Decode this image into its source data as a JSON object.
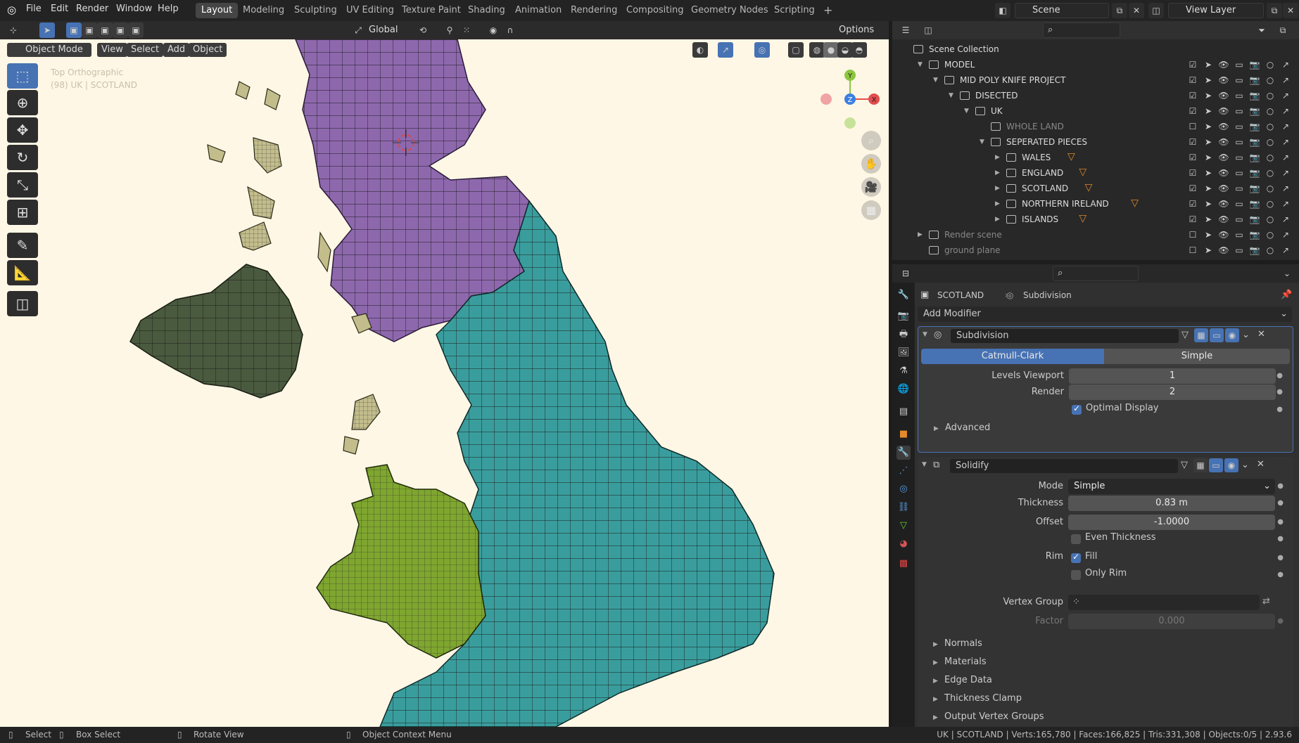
{
  "menu": {
    "file": "File",
    "edit": "Edit",
    "render": "Render",
    "window": "Window",
    "help": "Help"
  },
  "workspaces": [
    "Layout",
    "Modeling",
    "Sculpting",
    "UV Editing",
    "Texture Paint",
    "Shading",
    "Animation",
    "Rendering",
    "Compositing",
    "Geometry Nodes",
    "Scripting"
  ],
  "scene": "Scene",
  "view_layer": "View Layer",
  "viewport": {
    "orientation": "Global",
    "options": "Options",
    "mode": "Object Mode",
    "view": "View",
    "select": "Select",
    "add": "Add",
    "object": "Object",
    "overlay_title": "Top Orthographic",
    "overlay_sub": "(98) UK | SCOTLAND"
  },
  "gizmo": {
    "x": "X",
    "y": "Y",
    "z": "Z"
  },
  "outliner": {
    "rows": [
      {
        "label": "Scene Collection"
      },
      {
        "label": "MODEL"
      },
      {
        "label": "MID POLY KNIFE PROJECT"
      },
      {
        "label": "DISECTED"
      },
      {
        "label": "UK"
      },
      {
        "label": "WHOLE LAND"
      },
      {
        "label": "SEPERATED PIECES"
      },
      {
        "label": "WALES"
      },
      {
        "label": "ENGLAND"
      },
      {
        "label": "SCOTLAND"
      },
      {
        "label": "NORTHERN IRELAND"
      },
      {
        "label": "ISLANDS"
      },
      {
        "label": "Render scene"
      },
      {
        "label": "ground plane"
      }
    ]
  },
  "props": {
    "breadcrumb_object": "SCOTLAND",
    "breadcrumb_modifier": "Subdivision",
    "add_modifier": "Add Modifier",
    "subdivision": {
      "name": "Subdivision",
      "catmull": "Catmull-Clark",
      "simple": "Simple",
      "levels_label": "Levels Viewport",
      "levels": "1",
      "render_label": "Render",
      "render": "2",
      "optimal": "Optimal Display",
      "advanced": "Advanced"
    },
    "solidify": {
      "name": "Solidify",
      "mode_label": "Mode",
      "mode": "Simple",
      "thickness_label": "Thickness",
      "thickness": "0.83 m",
      "offset_label": "Offset",
      "offset": "-1.0000",
      "even": "Even Thickness",
      "rim_label": "Rim",
      "fill": "Fill",
      "only_rim": "Only Rim",
      "vgroup_label": "Vertex Group",
      "factor_label": "Factor",
      "factor": "0.000",
      "normals": "Normals",
      "materials": "Materials",
      "edge_data": "Edge Data",
      "thickness_clamp": "Thickness Clamp",
      "output_vg": "Output Vertex Groups"
    }
  },
  "status": {
    "select": "Select",
    "box_select": "Box Select",
    "rotate": "Rotate View",
    "context": "Object Context Menu",
    "stats": "UK | SCOTLAND | Verts:165,780 | Faces:166,825 | Tris:331,308 | Objects:0/5 | 2.93.6"
  },
  "colors": {
    "scotland": "#8e68ad",
    "england": "#3a9d9d",
    "wales": "#7fa62f",
    "nireland": "#4a5a3e",
    "islands": "#c3bd8c",
    "bg": "#fff7e5"
  }
}
